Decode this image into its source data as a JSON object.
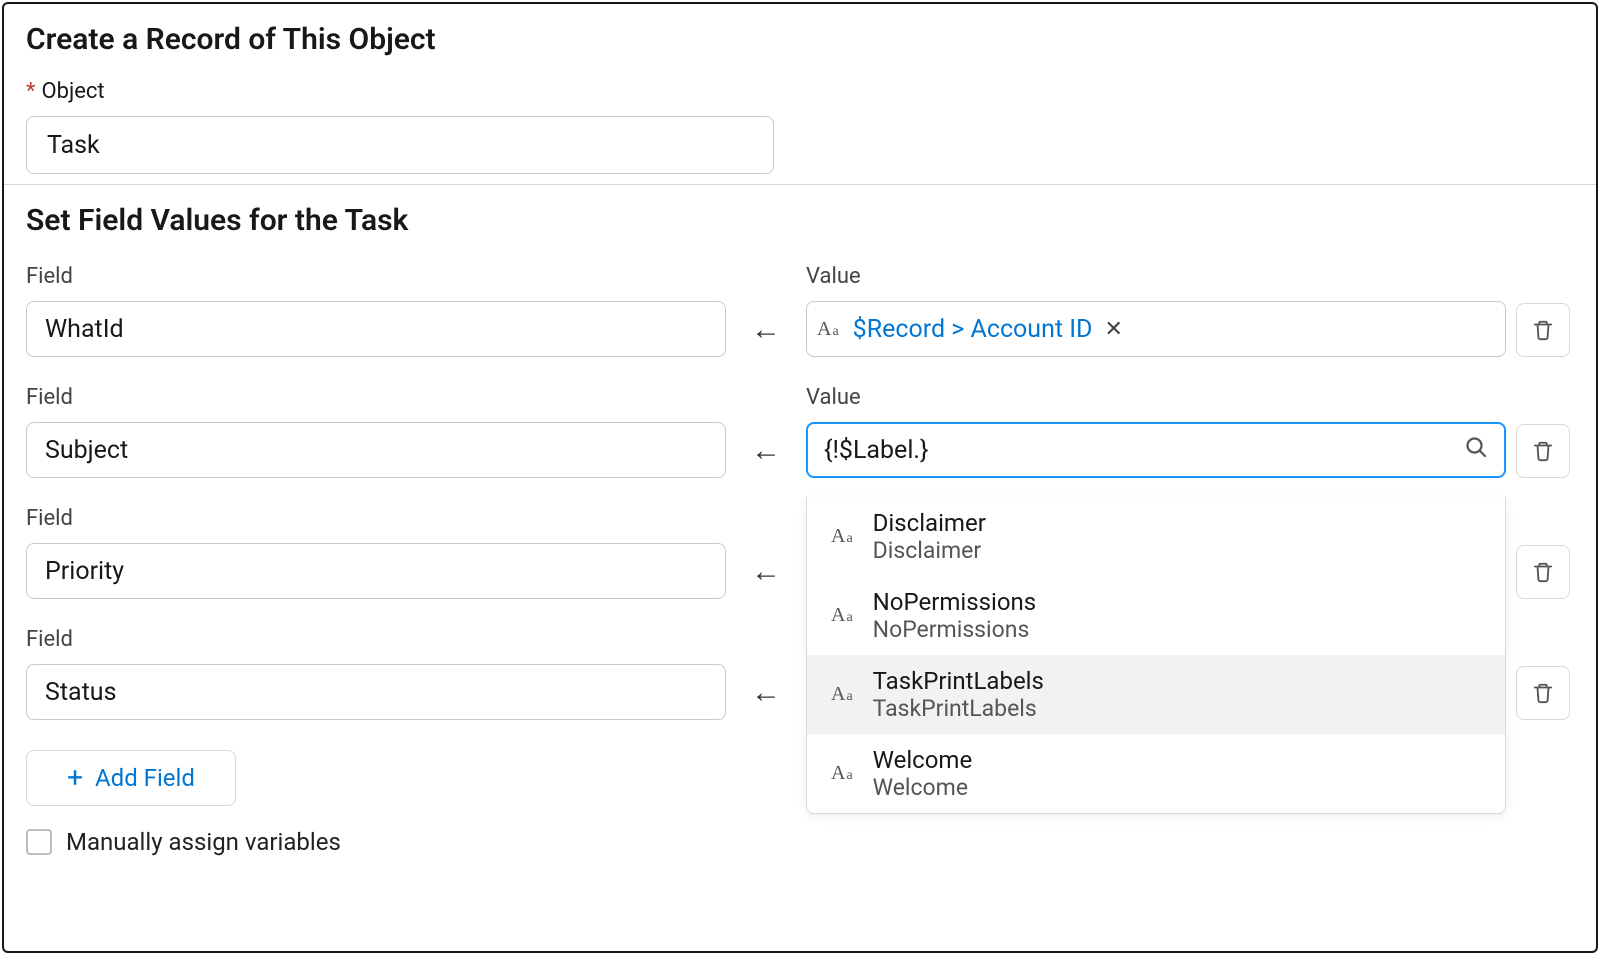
{
  "header": {
    "title": "Create a Record of This Object",
    "object_label": "Object",
    "object_value": "Task"
  },
  "fields_section": {
    "title": "Set Field Values for the Task",
    "field_label": "Field",
    "value_label": "Value",
    "rows": [
      {
        "field": "WhatId",
        "value_type": "pill",
        "pill_text": "$Record > Account ID"
      },
      {
        "field": "Subject",
        "value_type": "search",
        "search_text": "{!$Label.}"
      },
      {
        "field": "Priority",
        "value_type": "none"
      },
      {
        "field": "Status",
        "value_type": "none"
      }
    ],
    "dropdown": [
      {
        "primary": "Disclaimer",
        "secondary": "Disclaimer",
        "highlight": false
      },
      {
        "primary": "NoPermissions",
        "secondary": "NoPermissions",
        "highlight": false
      },
      {
        "primary": "TaskPrintLabels",
        "secondary": "TaskPrintLabels",
        "highlight": true
      },
      {
        "primary": "Welcome",
        "secondary": "Welcome",
        "highlight": false
      }
    ],
    "add_field_label": "Add Field",
    "checkbox_label": "Manually assign variables"
  }
}
